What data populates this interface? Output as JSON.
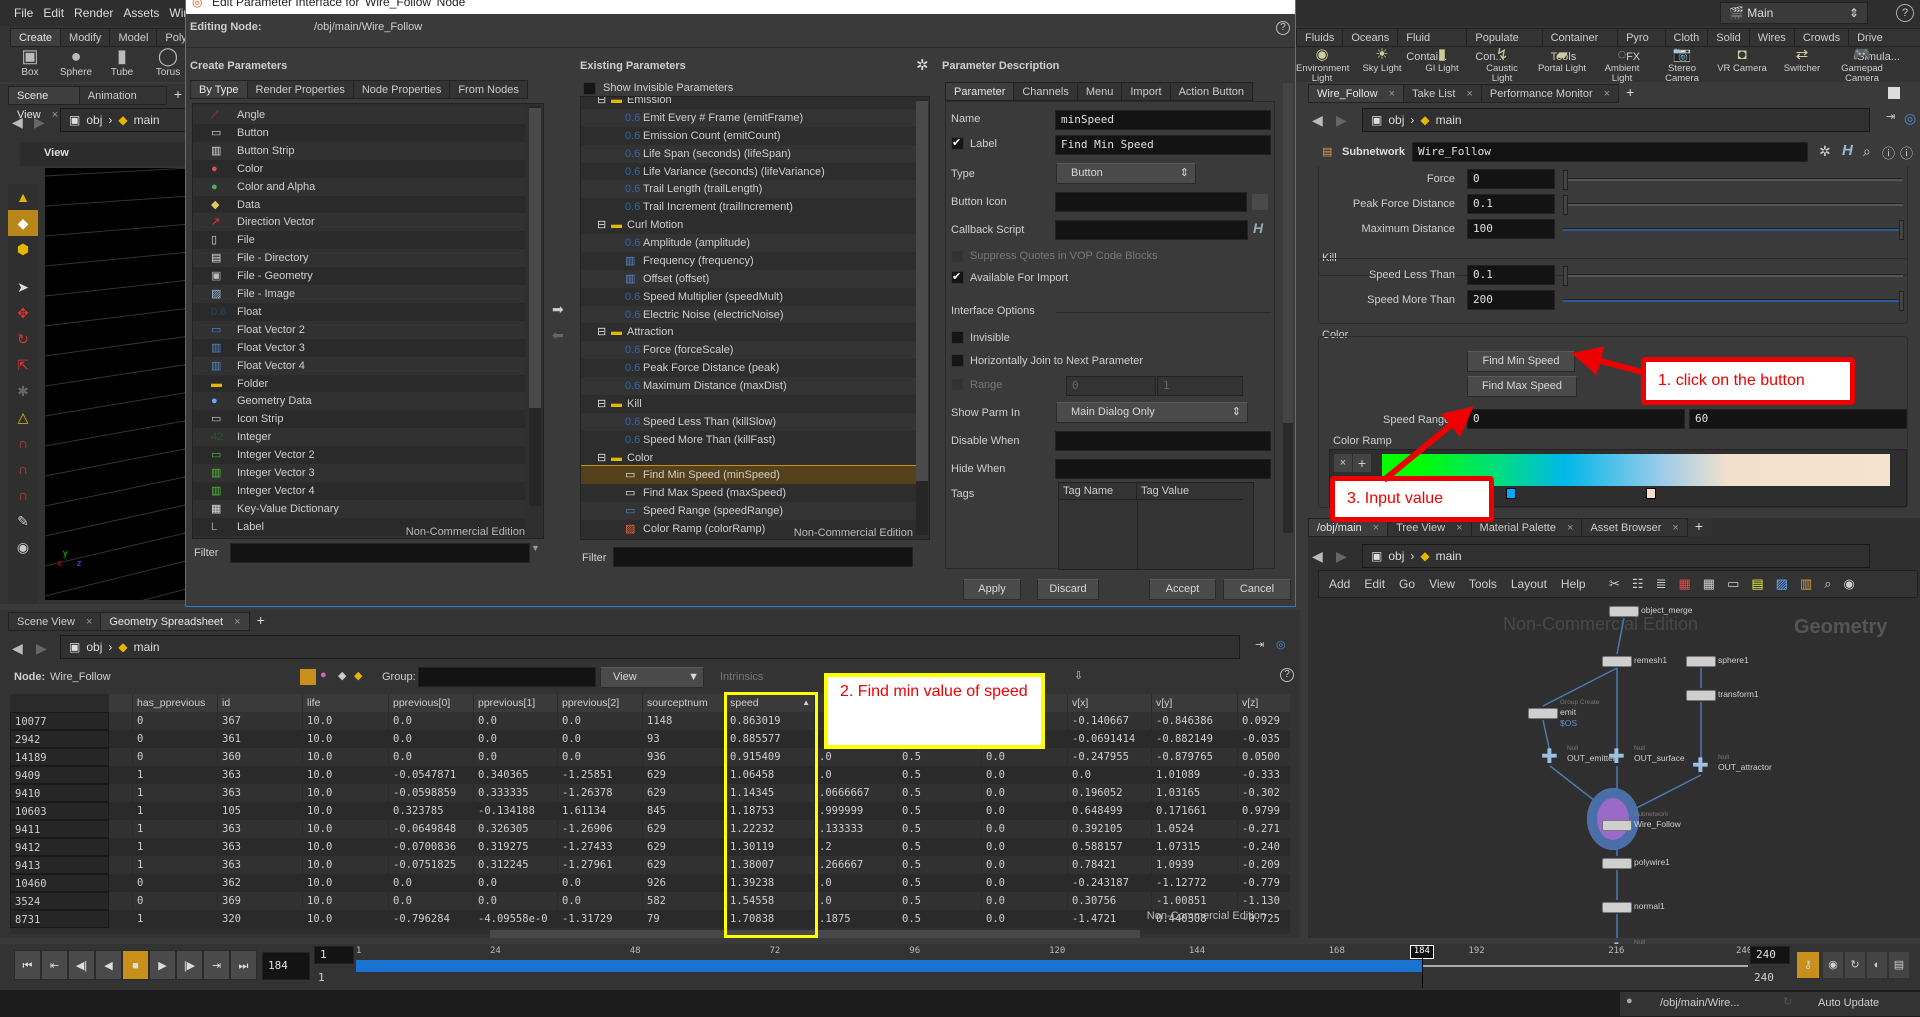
{
  "menubar": {
    "items": [
      "File",
      "Edit",
      "Render",
      "Assets",
      "Windows"
    ]
  },
  "shelf_left": {
    "tabs": [
      "Create",
      "Modify",
      "Model",
      "Polygon"
    ],
    "tools": [
      "Box",
      "Sphere",
      "Tube",
      "Torus"
    ]
  },
  "shelf_right": {
    "tabs": [
      "Fluids",
      "Oceans",
      "Fluid Contai...",
      "Populate Con...",
      "Container Tools",
      "Pyro FX",
      "Cloth",
      "Solid",
      "Wires",
      "Crowds",
      "Drive Simula..."
    ],
    "tools": [
      "Environment Light",
      "Sky Light",
      "GI Light",
      "Caustic Light",
      "Portal Light",
      "Ambient Light",
      "Stereo Camera",
      "VR Camera",
      "Switcher",
      "Gamepad Camera"
    ]
  },
  "desktop": {
    "value": "Main"
  },
  "scene_view": {
    "tabs": [
      "Scene View",
      "Animation Editor"
    ],
    "path": [
      "obj",
      "main"
    ],
    "view_label": "View"
  },
  "dialog": {
    "title": "Edit Parameter Interface for 'Wire_Follow' Node",
    "editing_node_label": "Editing Node:",
    "editing_node_path": "/obj/main/Wire_Follow",
    "create": {
      "heading": "Create Parameters",
      "tabs": [
        "By Type",
        "Render Properties",
        "Node Properties",
        "From Nodes"
      ],
      "items": [
        "Angle",
        "Button",
        "Button Strip",
        "Color",
        "Color and Alpha",
        "Data",
        "Direction Vector",
        "File",
        "File - Directory",
        "File - Geometry",
        "File - Image",
        "Float",
        "Float Vector 2",
        "Float Vector 3",
        "Float Vector 4",
        "Folder",
        "Geometry Data",
        "Icon Strip",
        "Integer",
        "Integer Vector 2",
        "Integer Vector 3",
        "Integer Vector 4",
        "Key-Value Dictionary",
        "Label"
      ],
      "filter_label": "Filter",
      "watermark": "Non-Commercial Edition"
    },
    "existing": {
      "heading": "Existing Parameters",
      "show_invisible": "Show Invisible Parameters",
      "tree": [
        {
          "folder": "Emission",
          "items": [
            [
              "float",
              "Emit Every # Frame (emitFrame)"
            ],
            [
              "float",
              "Emission Count (emitCount)"
            ],
            [
              "float",
              "Life Span (seconds) (lifeSpan)"
            ],
            [
              "float",
              "Life Variance (seconds) (lifeVariance)"
            ],
            [
              "float",
              "Trail Length (trailLength)"
            ],
            [
              "float",
              "Trail Increment (trailIncrement)"
            ]
          ]
        },
        {
          "folder": "Curl Motion",
          "items": [
            [
              "float",
              "Amplitude (amplitude)"
            ],
            [
              "vec3",
              "Frequency (frequency)"
            ],
            [
              "vec3",
              "Offset (offset)"
            ],
            [
              "float",
              "Speed Multiplier (speedMult)"
            ],
            [
              "float",
              "Electric Noise (electricNoise)"
            ]
          ]
        },
        {
          "folder": "Attraction",
          "items": [
            [
              "float",
              "Force (forceScale)"
            ],
            [
              "float",
              "Peak Force Distance (peak)"
            ],
            [
              "float",
              "Maximum Distance (maxDist)"
            ]
          ]
        },
        {
          "folder": "Kill",
          "items": [
            [
              "float",
              "Speed Less Than (killSlow)"
            ],
            [
              "float",
              "Speed More Than (killFast)"
            ]
          ]
        },
        {
          "folder": "Color",
          "items": [
            [
              "button",
              "Find Min Speed (minSpeed)"
            ],
            [
              "button",
              "Find Max Speed (maxSpeed)"
            ],
            [
              "vec2",
              "Speed Range (speedRange)"
            ],
            [
              "ramp",
              "Color Ramp (colorRamp)"
            ]
          ]
        }
      ],
      "selected": "Find Min Speed (minSpeed)",
      "filter_label": "Filter",
      "watermark": "Non-Commercial Edition"
    },
    "description": {
      "heading": "Parameter Description",
      "tabs": [
        "Parameter",
        "Channels",
        "Menu",
        "Import",
        "Action Button"
      ],
      "name_label": "Name",
      "name_value": "minSpeed",
      "label_label": "Label",
      "label_value": "Find Min Speed",
      "type_label": "Type",
      "type_value": "Button",
      "button_icon_label": "Button Icon",
      "callback_label": "Callback Script",
      "suppress_label": "Suppress Quotes in VOP Code Blocks",
      "available_label": "Available For Import",
      "interface_heading": "Interface Options",
      "invisible_label": "Invisible",
      "join_label": "Horizontally Join to Next Parameter",
      "range_label": "Range",
      "range_min": "0",
      "range_max": "1",
      "show_parm_label": "Show Parm In",
      "show_parm_value": "Main Dialog Only",
      "disable_label": "Disable When",
      "hide_label": "Hide When",
      "tags_label": "Tags",
      "tag_cols": [
        "Tag Name",
        "Tag Value"
      ]
    },
    "buttons": {
      "apply": "Apply",
      "discard": "Discard",
      "accept": "Accept",
      "cancel": "Cancel"
    }
  },
  "param_pane": {
    "tabs": [
      "Wire_Follow",
      "Take List",
      "Performance Monitor"
    ],
    "path": [
      "obj",
      "main"
    ],
    "node_type": "Subnetwork",
    "node_name": "Wire_Follow",
    "attraction": [
      {
        "label": "Force",
        "value": "0",
        "fill": 0
      },
      {
        "label": "Peak Force Distance",
        "value": "0.1",
        "fill": 0
      },
      {
        "label": "Maximum Distance",
        "value": "100",
        "fill": 1
      }
    ],
    "kill_heading": "Kill",
    "kill": [
      {
        "label": "Speed Less Than",
        "value": "0.1",
        "fill": 0
      },
      {
        "label": "Speed More Than",
        "value": "200",
        "fill": 1
      }
    ],
    "color_heading": "Color",
    "find_min": "Find Min Speed",
    "find_max": "Find Max Speed",
    "speed_range_label": "Speed Range",
    "speed_range_min": "0",
    "speed_range_max": "60",
    "color_ramp_label": "Color Ramp",
    "ramp_colors": [
      "#00ff00",
      "#00d890",
      "#00b8e8",
      "#9ccbea",
      "#f2e0cc",
      "#f5e3d0"
    ]
  },
  "network_pane": {
    "tabs": [
      "/obj/main",
      "Tree View",
      "Material Palette",
      "Asset Browser"
    ],
    "path": [
      "obj",
      "main"
    ],
    "menu": [
      "Add",
      "Edit",
      "Go",
      "View",
      "Tools",
      "Layout",
      "Help"
    ],
    "watermark": "Non-Commercial Edition",
    "context": "Geometry",
    "nodes": [
      {
        "name": "object_merge"
      },
      {
        "name": "remesh1"
      },
      {
        "name": "sphere1"
      },
      {
        "name": "transform1"
      },
      {
        "name": "emit",
        "subtitle": "Group Create",
        "extra": "$OS"
      },
      {
        "name": "OUT_emitter",
        "subtitle": "Null"
      },
      {
        "name": "OUT_surface",
        "subtitle": "Null"
      },
      {
        "name": "OUT_attractor",
        "subtitle": "Null"
      },
      {
        "name": "Wire_Follow",
        "subtitle": "Subnetwork"
      },
      {
        "name": "polywire1"
      },
      {
        "name": "normal1"
      },
      {
        "name": "OUT",
        "subtitle": "Null"
      }
    ]
  },
  "spreadsheet": {
    "tabs": [
      "Scene View",
      "Geometry Spreadsheet"
    ],
    "path": [
      "obj",
      "main"
    ],
    "node_label": "Node:",
    "node_value": "Wire_Follow",
    "group_label": "Group:",
    "view_label": "View",
    "intrinsics_label": "Intrinsics",
    "columns": [
      "",
      "",
      "has_pprevious",
      "id",
      "life",
      "pprevious[0]",
      "pprevious[1]",
      "pprevious[2]",
      "sourceptnum",
      "speed",
      "",
      "",
      "",
      "v[x]",
      "v[y]",
      "v[z]"
    ],
    "sorted_column": "speed",
    "rows": [
      [
        "10077",
        "",
        "0",
        "367",
        "10.0",
        "0.0",
        "0.0",
        "0.0",
        "1148",
        "0.863019",
        "",
        "",
        "",
        "-0.140667",
        "-0.846386",
        "0.0929"
      ],
      [
        "2942",
        "",
        "0",
        "361",
        "10.0",
        "0.0",
        "0.0",
        "0.0",
        "93",
        "0.885577",
        "",
        "",
        "",
        "-0.0691414",
        "-0.882149",
        "-0.035"
      ],
      [
        "14189",
        "",
        "0",
        "360",
        "10.0",
        "0.0",
        "0.0",
        "0.0",
        "936",
        "0.915409",
        ".0",
        "0.5",
        "0.0",
        "-0.247955",
        "-0.879765",
        "0.0500"
      ],
      [
        "9409",
        "",
        "1",
        "363",
        "10.0",
        "-0.0547871",
        "0.340365",
        "-1.25851",
        "629",
        "1.06458",
        ".0",
        "0.5",
        "0.0",
        "0.0",
        "1.01089",
        "-0.333"
      ],
      [
        "9410",
        "",
        "1",
        "363",
        "10.0",
        "-0.0598859",
        "0.333335",
        "-1.26378",
        "629",
        "1.14345",
        ".0666667",
        "0.5",
        "0.0",
        "0.196052",
        "1.03165",
        "-0.302"
      ],
      [
        "10603",
        "",
        "1",
        "105",
        "10.0",
        "0.323785",
        "-0.134188",
        "1.61134",
        "845",
        "1.18753",
        ".999999",
        "0.5",
        "0.0",
        "0.648499",
        "0.171661",
        "0.9799"
      ],
      [
        "9411",
        "",
        "1",
        "363",
        "10.0",
        "-0.0649848",
        "0.326305",
        "-1.26906",
        "629",
        "1.22232",
        ".133333",
        "0.5",
        "0.0",
        "0.392105",
        "1.0524",
        "-0.271"
      ],
      [
        "9412",
        "",
        "1",
        "363",
        "10.0",
        "-0.0700836",
        "0.319275",
        "-1.27433",
        "629",
        "1.30119",
        ".2",
        "0.5",
        "0.0",
        "0.588157",
        "1.07315",
        "-0.240"
      ],
      [
        "9413",
        "",
        "1",
        "363",
        "10.0",
        "-0.0751825",
        "0.312245",
        "-1.27961",
        "629",
        "1.38007",
        ".266667",
        "0.5",
        "0.0",
        "0.78421",
        "1.0939",
        "-0.209"
      ],
      [
        "10460",
        "",
        "0",
        "362",
        "10.0",
        "0.0",
        "0.0",
        "0.0",
        "926",
        "1.39238",
        ".0",
        "0.5",
        "0.0",
        "-0.243187",
        "-1.12772",
        "-0.779"
      ],
      [
        "3524",
        "",
        "0",
        "369",
        "10.0",
        "0.0",
        "0.0",
        "0.0",
        "582",
        "1.54558",
        ".0",
        "0.5",
        "0.0",
        "0.30756",
        "-1.00851",
        "-1.130"
      ],
      [
        "8731",
        "",
        "1",
        "320",
        "10.0",
        "-0.796284",
        "-4.09558e-0",
        "-1.31729",
        "79",
        "1.70838",
        ".1875",
        "0.5",
        "0.0",
        "-1.4721",
        "0.440308",
        "-0.725"
      ]
    ],
    "watermark": "Non-Commercial Edition"
  },
  "timeline": {
    "current_frame": "184",
    "start": "1",
    "start2": "1",
    "end": "240",
    "end2": "240",
    "range": [
      1,
      240
    ],
    "cached_to": 184,
    "ticks": [
      1,
      24,
      48,
      72,
      96,
      120,
      144,
      168,
      192,
      216,
      240
    ]
  },
  "statusbar": {
    "path": "/obj/main/Wire...",
    "update_mode": "Auto Update"
  },
  "annotations": {
    "step1": "1. click on the button",
    "step2": "2. Find min value of speed",
    "step3": "3. Input value",
    "highlight_color": "#ffff00",
    "arrow_color": "#ee0000"
  }
}
